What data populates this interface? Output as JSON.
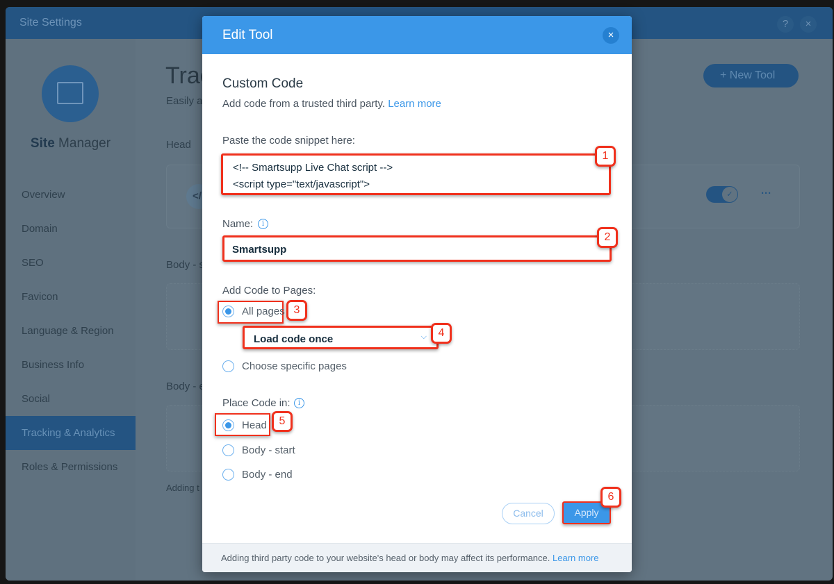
{
  "app": {
    "title": "Site Settings",
    "help_icon": "?",
    "close_icon": "×"
  },
  "sidebar": {
    "brand_bold": "Site",
    "brand_rest": " Manager",
    "items": [
      {
        "label": "Overview"
      },
      {
        "label": "Domain"
      },
      {
        "label": "SEO"
      },
      {
        "label": "Favicon"
      },
      {
        "label": "Language & Region"
      },
      {
        "label": "Business Info"
      },
      {
        "label": "Social"
      },
      {
        "label": "Tracking & Analytics",
        "selected": true
      },
      {
        "label": "Roles & Permissions"
      }
    ]
  },
  "main": {
    "title": "Trac",
    "subtitle": "Easily a",
    "new_tool": "New Tool",
    "head_label": "Head",
    "code_icon": "</",
    "more": "···",
    "body_start": "Body - s",
    "body_end": "Body - e",
    "adding": "Adding t"
  },
  "modal": {
    "title": "Edit Tool",
    "close": "×",
    "section_title": "Custom Code",
    "section_desc": "Add code from a trusted third party.",
    "learn_more": "Learn more",
    "snippet_label": "Paste the code snippet here:",
    "snippet_lines": [
      "<!-- Smartsupp Live Chat script -->",
      "<script type=\"text/javascript\">"
    ],
    "name_label": "Name:",
    "name_value": "Smartsupp",
    "pages_label": "Add Code to Pages:",
    "all_pages": "All pages",
    "load_option": "Load code once",
    "specific_pages": "Choose specific pages",
    "place_label": "Place Code in:",
    "place_options": [
      "Head",
      "Body - start",
      "Body - end"
    ],
    "place_selected": "Head",
    "cancel": "Cancel",
    "apply": "Apply",
    "footer": "Adding third party code to your website's head or body may affect its performance.",
    "footer_link": "Learn more"
  },
  "annotations": [
    "1",
    "2",
    "3",
    "4",
    "5",
    "6"
  ],
  "colors": {
    "accent": "#3b97e8",
    "annotation": "#f0311d"
  }
}
